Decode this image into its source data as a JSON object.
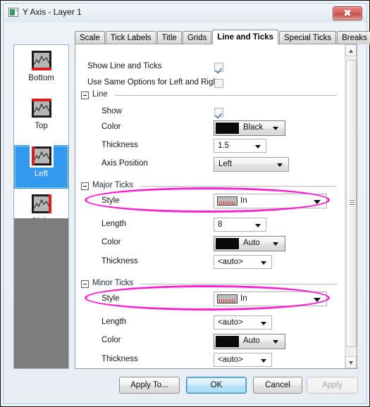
{
  "window": {
    "title": "Y Axis - Layer 1",
    "icon": "plot-window-icon",
    "close_label": "✖"
  },
  "tabs": [
    {
      "label": "Scale",
      "active": false
    },
    {
      "label": "Tick Labels",
      "active": false
    },
    {
      "label": "Title",
      "active": false
    },
    {
      "label": "Grids",
      "active": false
    },
    {
      "label": "Line and Ticks",
      "active": true
    },
    {
      "label": "Special Ticks",
      "active": false
    },
    {
      "label": "Breaks",
      "active": false
    }
  ],
  "sidebar": {
    "items": [
      {
        "label": "Bottom",
        "icon": "axis-bottom-icon",
        "selected": false
      },
      {
        "label": "Top",
        "icon": "axis-top-icon",
        "selected": false
      },
      {
        "label": "Left",
        "icon": "axis-left-icon",
        "selected": true
      },
      {
        "label": "Right",
        "icon": "axis-right-icon",
        "selected": false
      }
    ]
  },
  "main": {
    "show_line_and_ticks": {
      "label": "Show Line and Ticks",
      "checked": true
    },
    "use_same_options": {
      "label": "Use Same Options for Left and Right",
      "checked": false
    },
    "groups": [
      {
        "title": "Line",
        "rows": [
          {
            "label": "Show",
            "kind": "checkbox",
            "checked": true
          },
          {
            "label": "Color",
            "kind": "color",
            "value": "Black",
            "swatch": "#0a0a0a"
          },
          {
            "label": "Thickness",
            "kind": "combo",
            "value": "1.5"
          },
          {
            "label": "Axis Position",
            "kind": "combo3d",
            "value": "Left"
          }
        ]
      },
      {
        "title": "Major Ticks",
        "rows": [
          {
            "label": "Style",
            "kind": "style",
            "value": "In",
            "annotated": true
          },
          {
            "label": "Length",
            "kind": "combo",
            "value": "8"
          },
          {
            "label": "Color",
            "kind": "color",
            "value": "Auto",
            "swatch": "#0a0a0a"
          },
          {
            "label": "Thickness",
            "kind": "combo",
            "value": "<auto>"
          }
        ]
      },
      {
        "title": "Minor Ticks",
        "rows": [
          {
            "label": "Style",
            "kind": "style",
            "value": "In",
            "annotated": true
          },
          {
            "label": "Length",
            "kind": "combo",
            "value": "<auto>"
          },
          {
            "label": "Color",
            "kind": "color",
            "value": "Auto",
            "swatch": "#0a0a0a"
          },
          {
            "label": "Thickness",
            "kind": "combo",
            "value": "<auto>"
          }
        ]
      }
    ]
  },
  "footer": {
    "apply_to": "Apply To...",
    "ok": "OK",
    "cancel": "Cancel",
    "apply": "Apply"
  },
  "colors": {
    "annotation": "#ff1fd0",
    "selection": "#3399ee",
    "axis_highlight": "#e01b1b",
    "tick_preview": "#d83030"
  },
  "scrollbar": {
    "name": "vertical-scrollbar",
    "position_percent": 0
  }
}
